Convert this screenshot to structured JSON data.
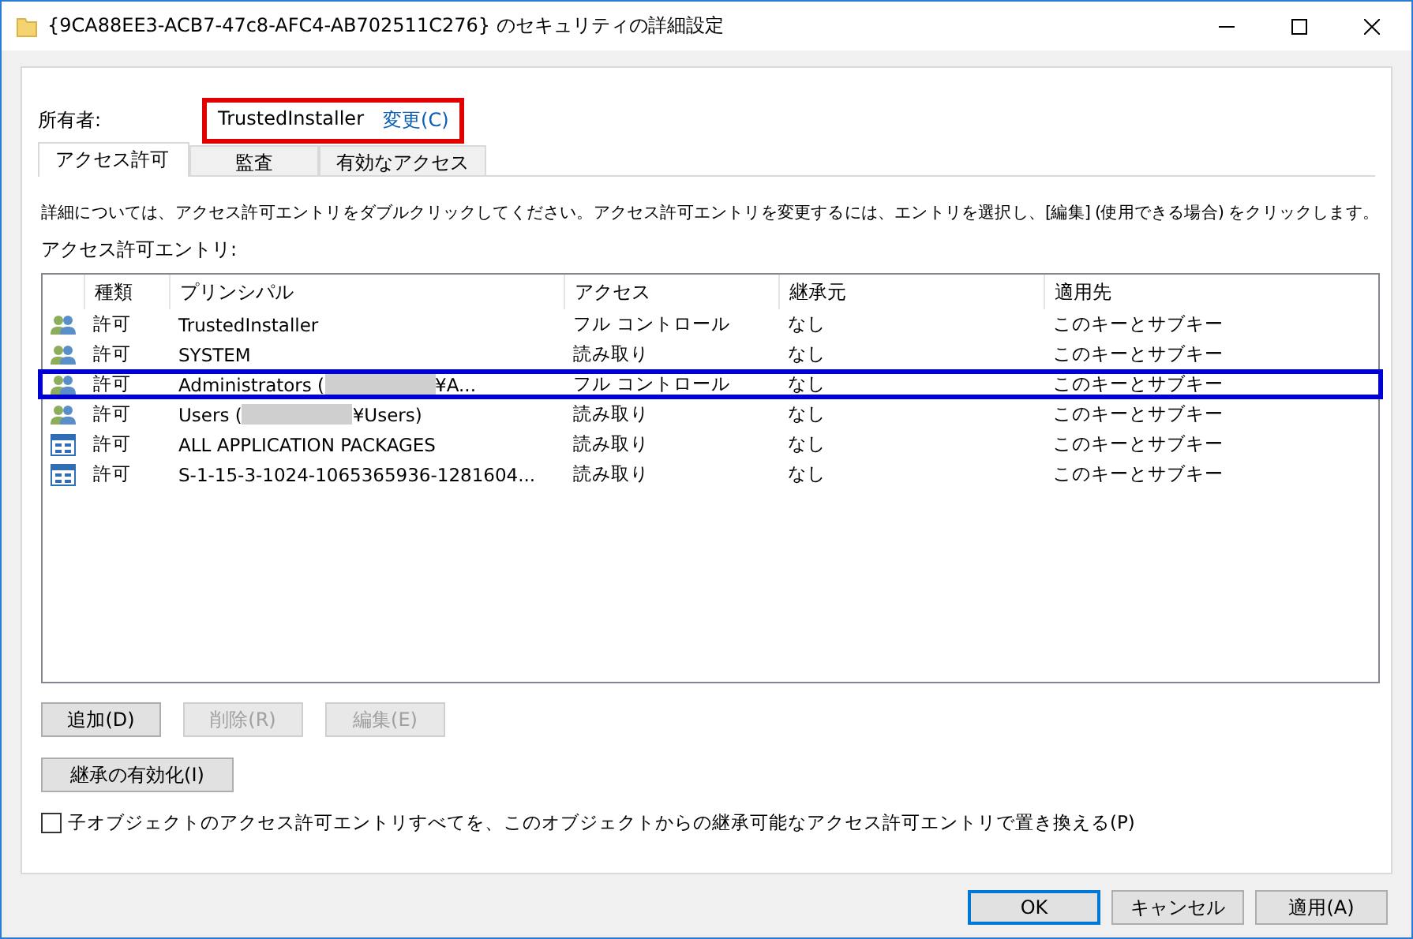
{
  "window": {
    "title": "{9CA88EE3-ACB7-47c8-AFC4-AB702511C276} のセキュリティの詳細設定"
  },
  "owner": {
    "label": "所有者:",
    "value": "TrustedInstaller",
    "change_link": "変更(C)",
    "highlighted": true
  },
  "tabs": [
    {
      "label": "アクセス許可",
      "selected": true
    },
    {
      "label": "監査",
      "selected": false
    },
    {
      "label": "有効なアクセス",
      "selected": false
    }
  ],
  "description": "詳細については、アクセス許可エントリをダブルクリックしてください。アクセス許可エントリを変更するには、エントリを選択し、[編集] (使用できる場合) をクリックします。",
  "entries_label": "アクセス許可エントリ:",
  "table": {
    "columns": [
      "種類",
      "プリンシパル",
      "アクセス",
      "継承元",
      "適用先"
    ],
    "rows": [
      {
        "kind": "group",
        "type": "許可",
        "principal": "TrustedInstaller",
        "redacted": false,
        "access": "フル コントロール",
        "inherited_from": "なし",
        "applies_to": "このキーとサブキー",
        "highlighted": false
      },
      {
        "kind": "group",
        "type": "許可",
        "principal": "SYSTEM",
        "redacted": false,
        "access": "読み取り",
        "inherited_from": "なし",
        "applies_to": "このキーとサブキー",
        "highlighted": false
      },
      {
        "kind": "group",
        "type": "許可",
        "principal": "Administrators (",
        "principal_suffix": "¥A...",
        "redacted": true,
        "access": "フル コントロール",
        "inherited_from": "なし",
        "applies_to": "このキーとサブキー",
        "highlighted": true
      },
      {
        "kind": "group",
        "type": "許可",
        "principal": "Users (",
        "principal_suffix": "¥Users)",
        "redacted": true,
        "access": "読み取り",
        "inherited_from": "なし",
        "applies_to": "このキーとサブキー",
        "highlighted": false
      },
      {
        "kind": "app",
        "type": "許可",
        "principal": "ALL APPLICATION PACKAGES",
        "redacted": false,
        "access": "読み取り",
        "inherited_from": "なし",
        "applies_to": "このキーとサブキー",
        "highlighted": false
      },
      {
        "kind": "app",
        "type": "許可",
        "principal": "S-1-15-3-1024-1065365936-1281604...",
        "redacted": false,
        "access": "読み取り",
        "inherited_from": "なし",
        "applies_to": "このキーとサブキー",
        "highlighted": false
      }
    ]
  },
  "entry_buttons": [
    {
      "label": "追加(D)",
      "disabled": false
    },
    {
      "label": "削除(R)",
      "disabled": true
    },
    {
      "label": "編集(E)",
      "disabled": true
    }
  ],
  "inheritance_button": {
    "label": "継承の有効化(I)",
    "disabled": false
  },
  "replace_checkbox": {
    "label": "子オブジェクトのアクセス許可エントリすべてを、このオブジェクトからの継承可能なアクセス許可エントリで置き換える(P)",
    "checked": false
  },
  "dialog_buttons": [
    {
      "label": "OK",
      "default": true
    },
    {
      "label": "キャンセル",
      "default": false
    },
    {
      "label": "適用(A)",
      "default": false
    }
  ]
}
